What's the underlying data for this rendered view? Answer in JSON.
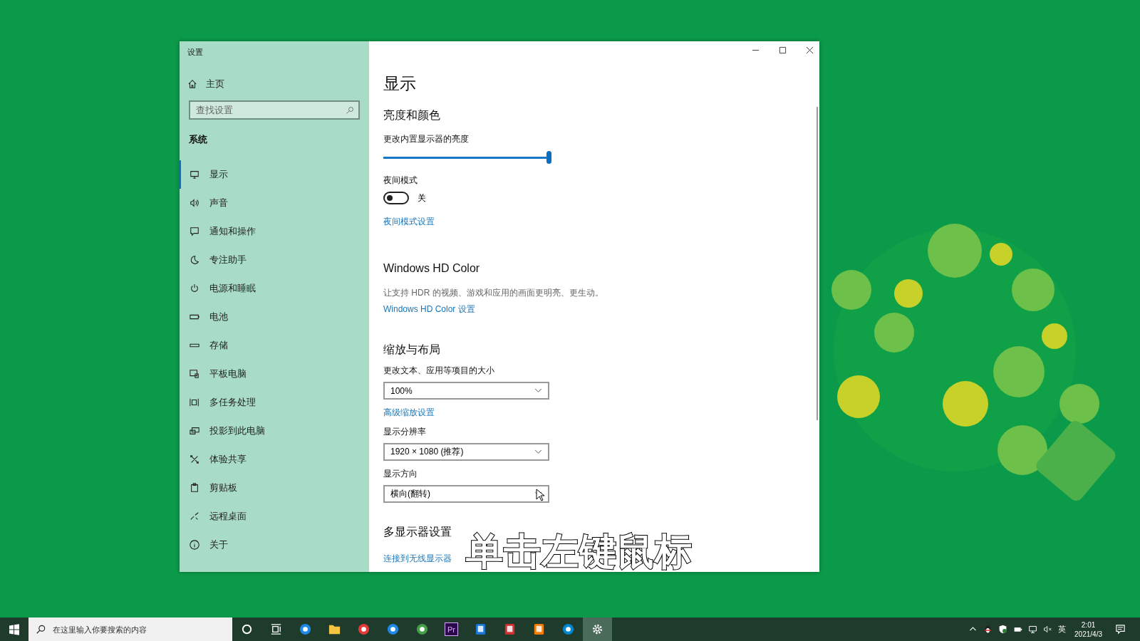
{
  "window": {
    "title": "设置"
  },
  "sidebar": {
    "home": "主页",
    "search": {
      "placeholder": "查找设置"
    },
    "section": "系统",
    "items": [
      {
        "label": "显示",
        "kind": "monitor",
        "selected": true
      },
      {
        "label": "声音",
        "kind": "speaker",
        "selected": false
      },
      {
        "label": "通知和操作",
        "kind": "message",
        "selected": false
      },
      {
        "label": "专注助手",
        "kind": "moon",
        "selected": false
      },
      {
        "label": "电源和睡眠",
        "kind": "power",
        "selected": false
      },
      {
        "label": "电池",
        "kind": "battery",
        "selected": false
      },
      {
        "label": "存储",
        "kind": "drive",
        "selected": false
      },
      {
        "label": "平板电脑",
        "kind": "tablet",
        "selected": false
      },
      {
        "label": "多任务处理",
        "kind": "multitask",
        "selected": false
      },
      {
        "label": "投影到此电脑",
        "kind": "project",
        "selected": false
      },
      {
        "label": "体验共享",
        "kind": "share",
        "selected": false
      },
      {
        "label": "剪贴板",
        "kind": "clipboard",
        "selected": false
      },
      {
        "label": "远程桌面",
        "kind": "remote",
        "selected": false
      },
      {
        "label": "关于",
        "kind": "info",
        "selected": false
      }
    ]
  },
  "content": {
    "title": "显示",
    "brightness": {
      "heading": "亮度和颜色",
      "label": "更改内置显示器的亮度",
      "level": 1
    },
    "night_light": {
      "label": "夜间模式",
      "on": false,
      "state_text": "关",
      "link": "夜间模式设置"
    },
    "hd_color": {
      "heading": "Windows HD Color",
      "description": "让支持 HDR 的视频、游戏和应用的画面更明亮、更生动。",
      "link": "Windows HD Color 设置"
    },
    "scale": {
      "heading": "缩放与布局",
      "items": [
        {
          "kind": "dropdown",
          "label": "更改文本、应用等项目的大小",
          "value": "100%"
        },
        {
          "kind": "link",
          "text": "高级缩放设置"
        },
        {
          "kind": "dropdown",
          "label": "显示分辨率",
          "value": "1920 × 1080 (推荐)"
        },
        {
          "kind": "dropdown",
          "label": "显示方向",
          "value": "横向(翻转)"
        }
      ]
    },
    "multi": {
      "heading": "多显示器设置",
      "link": "连接到无线显示器"
    }
  },
  "caption": "单击左键鼠标",
  "taskbar": {
    "search": {
      "placeholder": "在这里输入你要搜索的内容"
    },
    "apps": [
      {
        "kind": "cortana",
        "active": false
      },
      {
        "kind": "taskview",
        "active": false
      },
      {
        "kind": "edge",
        "active": false
      },
      {
        "kind": "folder",
        "active": false
      },
      {
        "kind": "chrome",
        "active": false
      },
      {
        "kind": "ie",
        "active": false
      },
      {
        "kind": "chrome360",
        "active": false
      },
      {
        "kind": "premiere",
        "label": "Pr",
        "active": false
      },
      {
        "kind": "phone",
        "active": false
      },
      {
        "kind": "wps",
        "active": false
      },
      {
        "kind": "slides",
        "active": false
      },
      {
        "kind": "browser",
        "active": false
      },
      {
        "kind": "settings",
        "active": true
      }
    ],
    "input_method": "英",
    "time": "2:01",
    "date": "2021/4/3"
  }
}
